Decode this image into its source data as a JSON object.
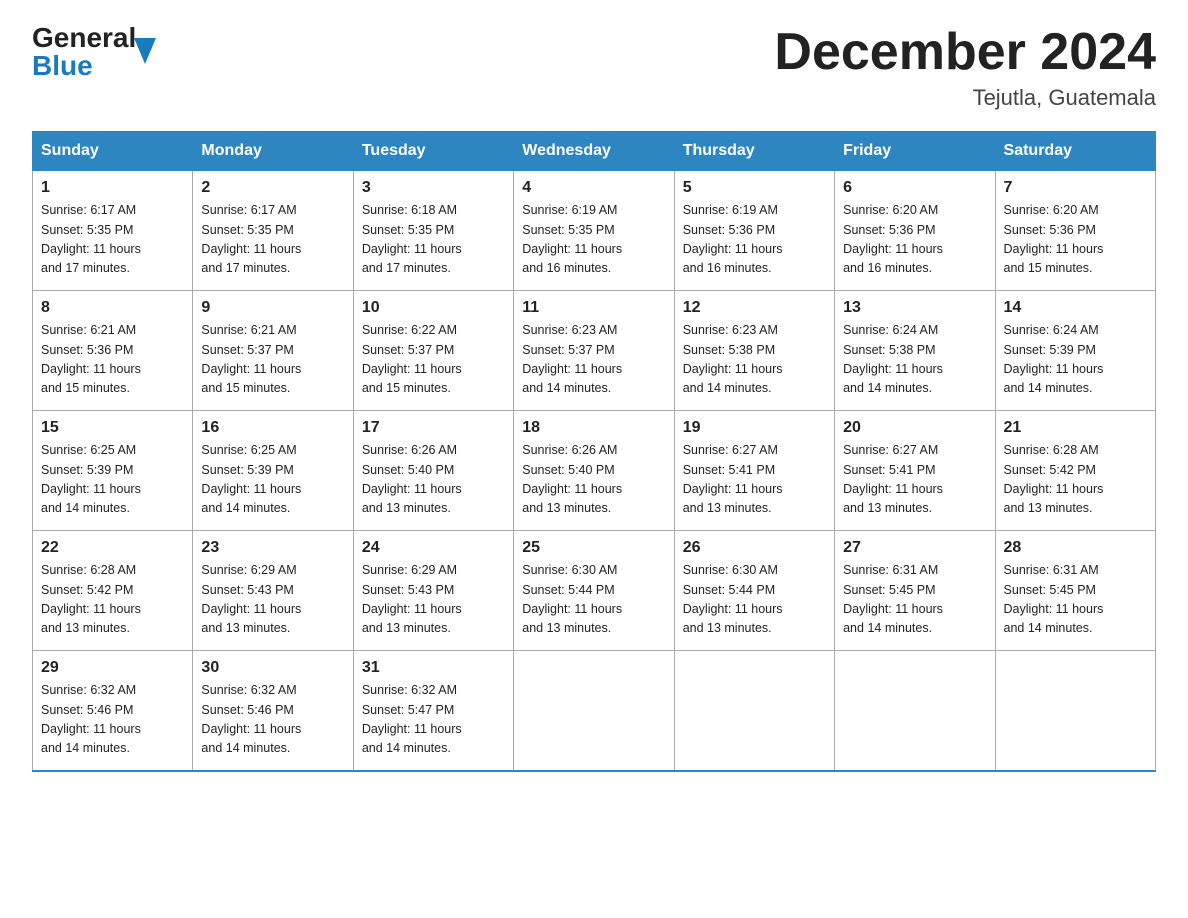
{
  "header": {
    "logo_general": "General",
    "logo_blue": "Blue",
    "title": "December 2024",
    "subtitle": "Tejutla, Guatemala"
  },
  "days_of_week": [
    "Sunday",
    "Monday",
    "Tuesday",
    "Wednesday",
    "Thursday",
    "Friday",
    "Saturday"
  ],
  "weeks": [
    [
      {
        "day": "1",
        "sunrise": "6:17 AM",
        "sunset": "5:35 PM",
        "daylight": "11 hours and 17 minutes."
      },
      {
        "day": "2",
        "sunrise": "6:17 AM",
        "sunset": "5:35 PM",
        "daylight": "11 hours and 17 minutes."
      },
      {
        "day": "3",
        "sunrise": "6:18 AM",
        "sunset": "5:35 PM",
        "daylight": "11 hours and 17 minutes."
      },
      {
        "day": "4",
        "sunrise": "6:19 AM",
        "sunset": "5:35 PM",
        "daylight": "11 hours and 16 minutes."
      },
      {
        "day": "5",
        "sunrise": "6:19 AM",
        "sunset": "5:36 PM",
        "daylight": "11 hours and 16 minutes."
      },
      {
        "day": "6",
        "sunrise": "6:20 AM",
        "sunset": "5:36 PM",
        "daylight": "11 hours and 16 minutes."
      },
      {
        "day": "7",
        "sunrise": "6:20 AM",
        "sunset": "5:36 PM",
        "daylight": "11 hours and 15 minutes."
      }
    ],
    [
      {
        "day": "8",
        "sunrise": "6:21 AM",
        "sunset": "5:36 PM",
        "daylight": "11 hours and 15 minutes."
      },
      {
        "day": "9",
        "sunrise": "6:21 AM",
        "sunset": "5:37 PM",
        "daylight": "11 hours and 15 minutes."
      },
      {
        "day": "10",
        "sunrise": "6:22 AM",
        "sunset": "5:37 PM",
        "daylight": "11 hours and 15 minutes."
      },
      {
        "day": "11",
        "sunrise": "6:23 AM",
        "sunset": "5:37 PM",
        "daylight": "11 hours and 14 minutes."
      },
      {
        "day": "12",
        "sunrise": "6:23 AM",
        "sunset": "5:38 PM",
        "daylight": "11 hours and 14 minutes."
      },
      {
        "day": "13",
        "sunrise": "6:24 AM",
        "sunset": "5:38 PM",
        "daylight": "11 hours and 14 minutes."
      },
      {
        "day": "14",
        "sunrise": "6:24 AM",
        "sunset": "5:39 PM",
        "daylight": "11 hours and 14 minutes."
      }
    ],
    [
      {
        "day": "15",
        "sunrise": "6:25 AM",
        "sunset": "5:39 PM",
        "daylight": "11 hours and 14 minutes."
      },
      {
        "day": "16",
        "sunrise": "6:25 AM",
        "sunset": "5:39 PM",
        "daylight": "11 hours and 14 minutes."
      },
      {
        "day": "17",
        "sunrise": "6:26 AM",
        "sunset": "5:40 PM",
        "daylight": "11 hours and 13 minutes."
      },
      {
        "day": "18",
        "sunrise": "6:26 AM",
        "sunset": "5:40 PM",
        "daylight": "11 hours and 13 minutes."
      },
      {
        "day": "19",
        "sunrise": "6:27 AM",
        "sunset": "5:41 PM",
        "daylight": "11 hours and 13 minutes."
      },
      {
        "day": "20",
        "sunrise": "6:27 AM",
        "sunset": "5:41 PM",
        "daylight": "11 hours and 13 minutes."
      },
      {
        "day": "21",
        "sunrise": "6:28 AM",
        "sunset": "5:42 PM",
        "daylight": "11 hours and 13 minutes."
      }
    ],
    [
      {
        "day": "22",
        "sunrise": "6:28 AM",
        "sunset": "5:42 PM",
        "daylight": "11 hours and 13 minutes."
      },
      {
        "day": "23",
        "sunrise": "6:29 AM",
        "sunset": "5:43 PM",
        "daylight": "11 hours and 13 minutes."
      },
      {
        "day": "24",
        "sunrise": "6:29 AM",
        "sunset": "5:43 PM",
        "daylight": "11 hours and 13 minutes."
      },
      {
        "day": "25",
        "sunrise": "6:30 AM",
        "sunset": "5:44 PM",
        "daylight": "11 hours and 13 minutes."
      },
      {
        "day": "26",
        "sunrise": "6:30 AM",
        "sunset": "5:44 PM",
        "daylight": "11 hours and 13 minutes."
      },
      {
        "day": "27",
        "sunrise": "6:31 AM",
        "sunset": "5:45 PM",
        "daylight": "11 hours and 14 minutes."
      },
      {
        "day": "28",
        "sunrise": "6:31 AM",
        "sunset": "5:45 PM",
        "daylight": "11 hours and 14 minutes."
      }
    ],
    [
      {
        "day": "29",
        "sunrise": "6:32 AM",
        "sunset": "5:46 PM",
        "daylight": "11 hours and 14 minutes."
      },
      {
        "day": "30",
        "sunrise": "6:32 AM",
        "sunset": "5:46 PM",
        "daylight": "11 hours and 14 minutes."
      },
      {
        "day": "31",
        "sunrise": "6:32 AM",
        "sunset": "5:47 PM",
        "daylight": "11 hours and 14 minutes."
      },
      null,
      null,
      null,
      null
    ]
  ],
  "labels": {
    "sunrise_prefix": "Sunrise: ",
    "sunset_prefix": "Sunset: ",
    "daylight_prefix": "Daylight: "
  }
}
